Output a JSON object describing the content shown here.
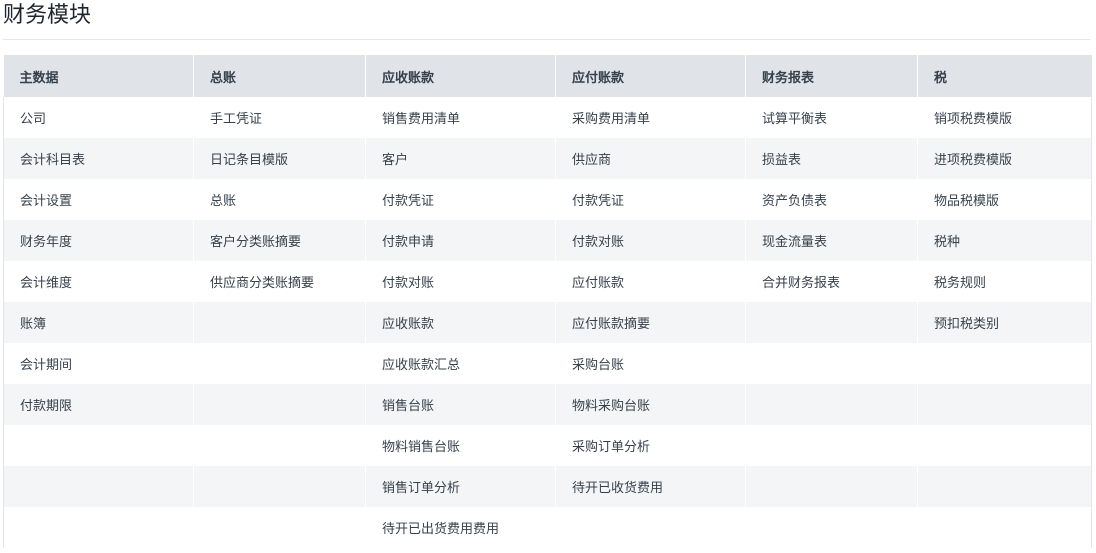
{
  "page": {
    "title": "财务模块"
  },
  "columns": [
    {
      "header": "主数据",
      "items": [
        "公司",
        "会计科目表",
        "会计设置",
        "财务年度",
        "会计维度",
        "账簿",
        "会计期间",
        "付款期限"
      ]
    },
    {
      "header": "总账",
      "items": [
        "手工凭证",
        "日记条目模版",
        "总账",
        "客户分类账摘要",
        "供应商分类账摘要"
      ]
    },
    {
      "header": "应收账款",
      "items": [
        "销售费用清单",
        "客户",
        "付款凭证",
        "付款申请",
        "付款对账",
        "应收账款",
        "应收账款汇总",
        "销售台账",
        "物料销售台账",
        "销售订单分析",
        "待开已出货费用费用"
      ]
    },
    {
      "header": "应付账款",
      "items": [
        "采购费用清单",
        "供应商",
        "付款凭证",
        "付款对账",
        "应付账款",
        "应付账款摘要",
        "采购台账",
        "物料采购台账",
        "采购订单分析",
        "待开已收货费用"
      ]
    },
    {
      "header": "财务报表",
      "items": [
        "试算平衡表",
        "损益表",
        "资产负债表",
        "现金流量表",
        "合并财务报表"
      ]
    },
    {
      "header": "税",
      "items": [
        "销项税费模版",
        "进项税费模版",
        "物品税模版",
        "税种",
        "税务规则",
        "预扣税类别"
      ]
    }
  ],
  "colors": {
    "header_bg": "#e0e4e8",
    "stripe_bg": "#f4f5f6",
    "text": "#36414c",
    "divider": "#e2e6e9"
  }
}
